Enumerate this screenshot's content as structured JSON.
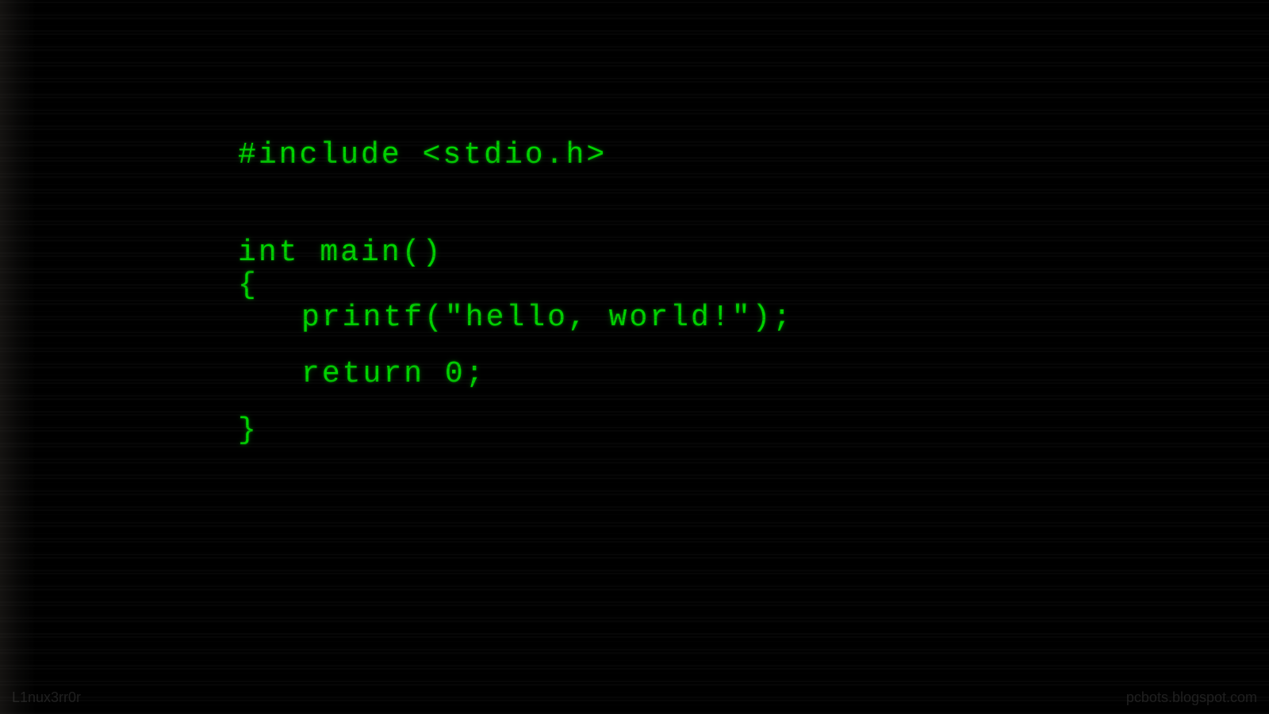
{
  "code": {
    "line1": "#include <stdio.h>",
    "line2": "int main()",
    "line3": "{",
    "line4": "printf(\"hello, world!\");",
    "line5": "return 0;",
    "line6": "}"
  },
  "watermark": {
    "left": "L1nux3rr0r",
    "right": "pcbots.blogspot.com"
  },
  "colors": {
    "background": "#000000",
    "text": "#00d400"
  }
}
